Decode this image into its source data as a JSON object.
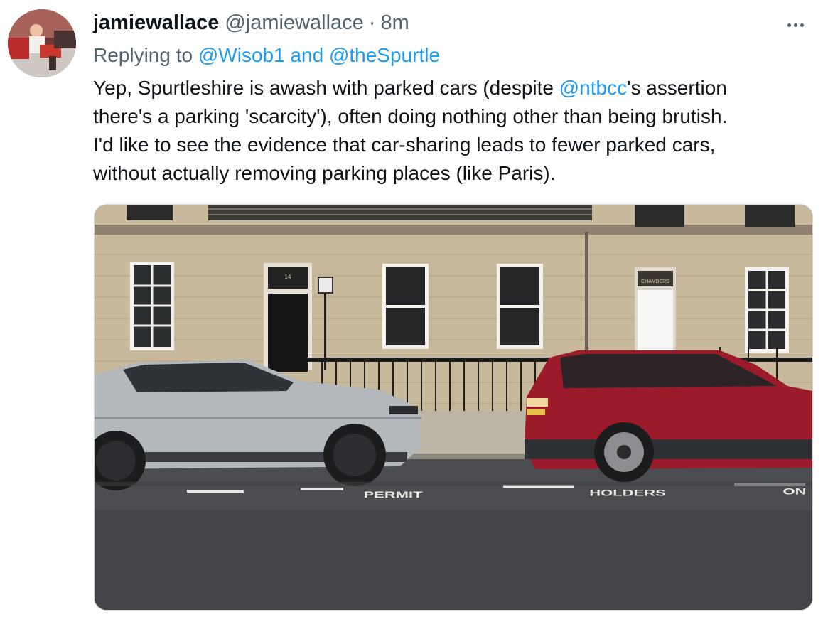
{
  "tweet": {
    "display_name": "jamiewallace",
    "handle": "@jamiewallace",
    "separator": "·",
    "time": "8m",
    "reply_prefix": "Replying to ",
    "reply_user_1": "@Wisob1",
    "reply_and": " and ",
    "reply_user_2": "@theSpurtle",
    "text": {
      "l1_a": "Yep, Spurtleshire is awash with parked cars (despite ",
      "l1_mention": "@ntbcc",
      "l1_b": "'s assertion",
      "l2": "there's a parking 'scarcity'), often doing nothing other than being brutish.",
      "l3": "I'd like to see the evidence that car-sharing leads to fewer parked cars,",
      "l4": "without actually removing parking places (like Paris)."
    },
    "photo": {
      "road_marking_1": "PERMIT",
      "road_marking_2": "HOLDERS",
      "road_marking_3": "ON",
      "door_number": "14",
      "plaque_text": "CHAMBERS"
    }
  },
  "colors": {
    "link": "#1d9bf0",
    "secondary_text": "#536471",
    "primary_text": "#0f1419"
  }
}
